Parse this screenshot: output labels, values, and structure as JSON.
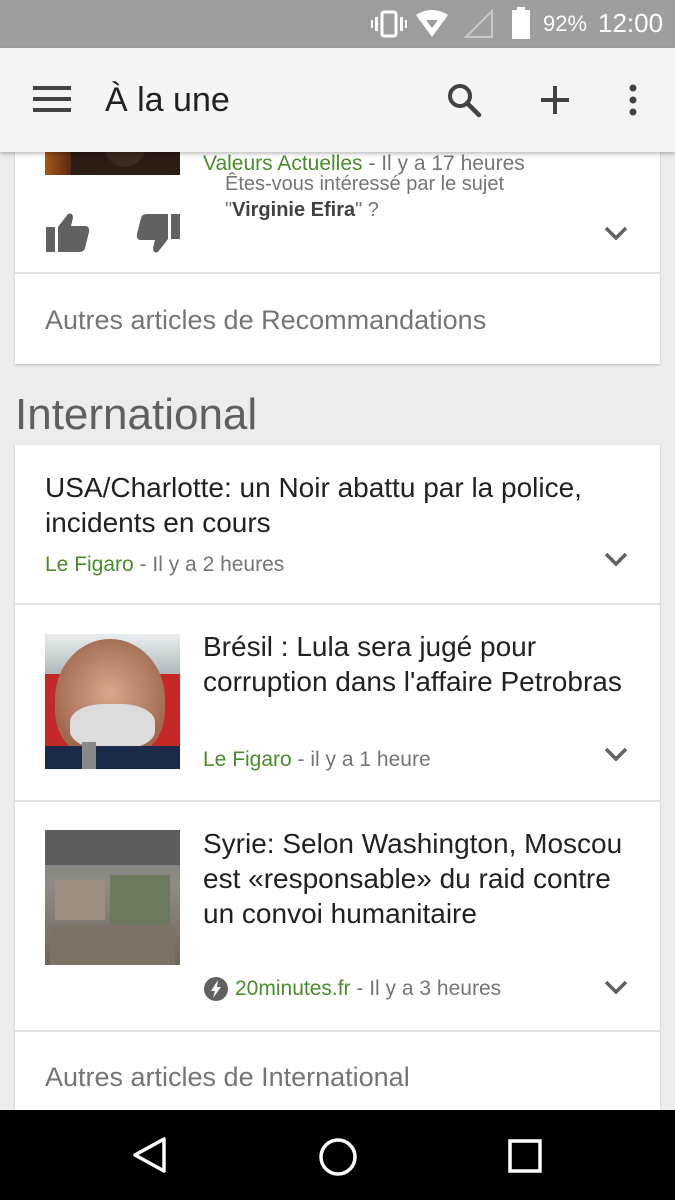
{
  "status_bar": {
    "battery_percent": "92%",
    "time": "12:00"
  },
  "app_bar": {
    "title": "À la une"
  },
  "recommendations": {
    "top_item": {
      "source": "Valeurs Actuelles",
      "time": " - Il y a 17 heures"
    },
    "interest_prompt": {
      "prefix": "Êtes-vous intéressé par le sujet",
      "open_quote": "\"",
      "topic": "Virginie Efira",
      "suffix": "\" ?"
    },
    "more_label": "Autres articles de Recommandations"
  },
  "international": {
    "section_title": "International",
    "articles": [
      {
        "headline": "USA/Charlotte: un Noir abattu par la police, incidents en cours",
        "source": "Le Figaro",
        "time": " - Il y a 2 heures"
      },
      {
        "headline": "Brésil : Lula sera jugé pour corruption dans l'affaire Petrobras",
        "source": "Le Figaro",
        "time": " - il y a 1 heure"
      },
      {
        "headline": "Syrie: Selon Washington, Moscou est «responsable» du raid contre un convoi humanitaire",
        "source": "20minutes.fr",
        "time": " - Il y a 3 heures",
        "source_icon": "amp-bolt-icon"
      }
    ],
    "more_label": "Autres articles de International"
  }
}
